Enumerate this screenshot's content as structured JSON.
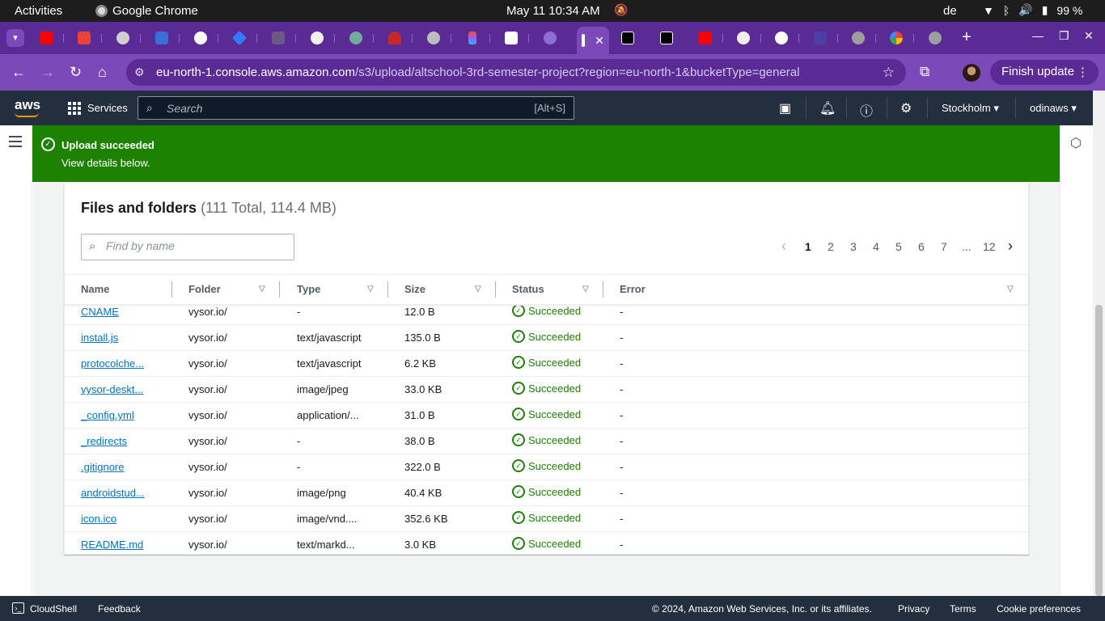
{
  "os": {
    "activities": "Activities",
    "app": "Google Chrome",
    "clock": "May 11  10:34 AM",
    "lang": "de",
    "battery": "99 %"
  },
  "browser": {
    "url_host": "eu-north-1.console.aws.amazon.com",
    "url_path": "/s3/upload/altschool-3rd-semester-project?region=eu-north-1&bucketType=general",
    "finish_update": "Finish update"
  },
  "aws": {
    "logo": "aws",
    "services": "Services",
    "search_placeholder": "Search",
    "search_shortcut": "[Alt+S]",
    "region": "Stockholm",
    "account": "odinaws"
  },
  "flash": {
    "title": "Upload succeeded",
    "body": "View details below."
  },
  "files": {
    "title": "Files and folders",
    "count": "(111 Total, 114.4 MB)",
    "find_placeholder": "Find by name",
    "pages": [
      "1",
      "2",
      "3",
      "4",
      "5",
      "6",
      "7",
      "...",
      "12"
    ],
    "columns": [
      "Name",
      "Folder",
      "Type",
      "Size",
      "Status",
      "Error"
    ],
    "rows": [
      {
        "name": "CNAME",
        "folder": "vysor.io/",
        "type": "-",
        "size": "12.0 B",
        "status": "Succeeded",
        "error": "-"
      },
      {
        "name": "install.js",
        "folder": "vysor.io/",
        "type": "text/javascript",
        "size": "135.0 B",
        "status": "Succeeded",
        "error": "-"
      },
      {
        "name": "protocolche...",
        "folder": "vysor.io/",
        "type": "text/javascript",
        "size": "6.2 KB",
        "status": "Succeeded",
        "error": "-"
      },
      {
        "name": "vysor-deskt...",
        "folder": "vysor.io/",
        "type": "image/jpeg",
        "size": "33.0 KB",
        "status": "Succeeded",
        "error": "-"
      },
      {
        "name": "_config.yml",
        "folder": "vysor.io/",
        "type": "application/...",
        "size": "31.0 B",
        "status": "Succeeded",
        "error": "-"
      },
      {
        "name": "_redirects",
        "folder": "vysor.io/",
        "type": "-",
        "size": "38.0 B",
        "status": "Succeeded",
        "error": "-"
      },
      {
        "name": ".gitignore",
        "folder": "vysor.io/",
        "type": "-",
        "size": "322.0 B",
        "status": "Succeeded",
        "error": "-"
      },
      {
        "name": "androidstud...",
        "folder": "vysor.io/",
        "type": "image/png",
        "size": "40.4 KB",
        "status": "Succeeded",
        "error": "-"
      },
      {
        "name": "icon.ico",
        "folder": "vysor.io/",
        "type": "image/vnd....",
        "size": "352.6 KB",
        "status": "Succeeded",
        "error": "-"
      },
      {
        "name": "README.md",
        "folder": "vysor.io/",
        "type": "text/markd...",
        "size": "3.0 KB",
        "status": "Succeeded",
        "error": "-"
      }
    ]
  },
  "footer": {
    "cloudshell": "CloudShell",
    "feedback": "Feedback",
    "copyright": "© 2024, Amazon Web Services, Inc. or its affiliates.",
    "privacy": "Privacy",
    "terms": "Terms",
    "cookies": "Cookie preferences"
  },
  "colors": {
    "success": "#1d8102",
    "aws_nav": "#232f3e",
    "chrome_tabs": "#5a2a95",
    "chrome_toolbar": "#7b4ab8",
    "link": "#0073bb"
  }
}
